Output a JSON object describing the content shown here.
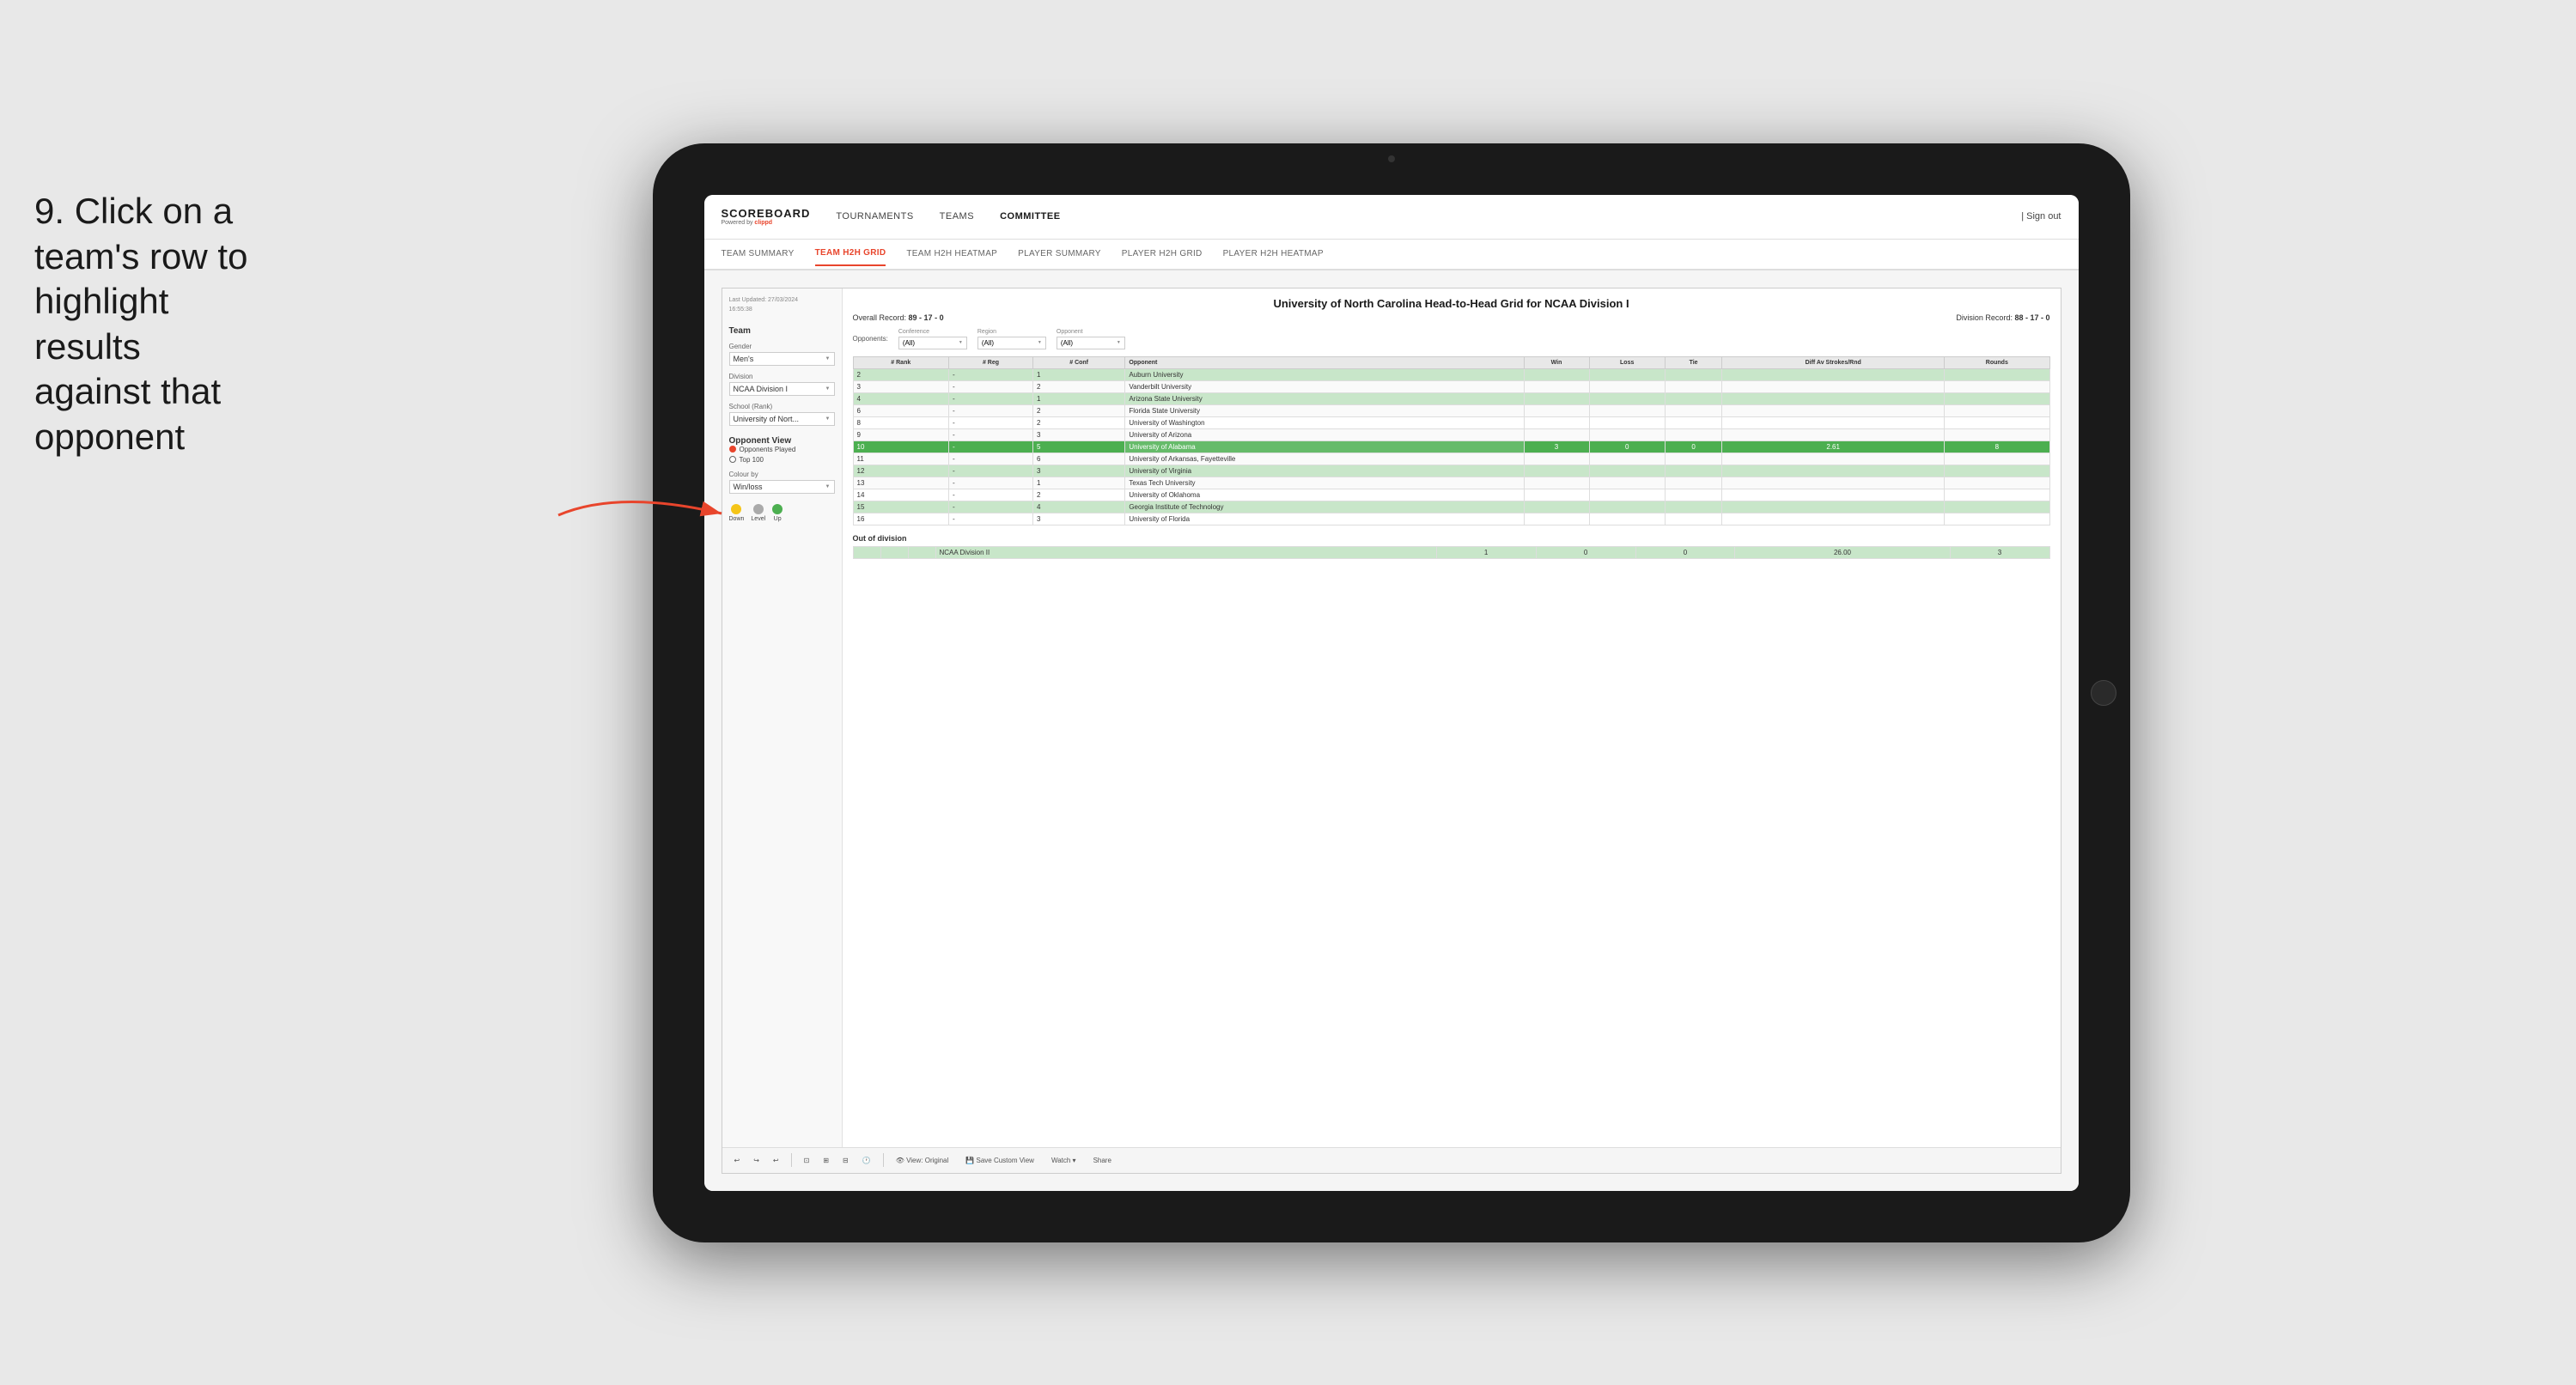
{
  "instruction": {
    "step": "9.",
    "text": "Click on a team's row to highlight results against that opponent"
  },
  "app": {
    "logo": "SCOREBOARD",
    "logo_sub": "Powered by clippd",
    "sign_out": "Sign out",
    "nav": {
      "tournaments": "TOURNAMENTS",
      "teams": "TEAMS",
      "committee": "COMMITTEE"
    },
    "sub_nav": [
      {
        "label": "TEAM SUMMARY",
        "active": false
      },
      {
        "label": "TEAM H2H GRID",
        "active": true
      },
      {
        "label": "TEAM H2H HEATMAP",
        "active": false
      },
      {
        "label": "PLAYER SUMMARY",
        "active": false
      },
      {
        "label": "PLAYER H2H GRID",
        "active": false
      },
      {
        "label": "PLAYER H2H HEATMAP",
        "active": false
      }
    ]
  },
  "sidebar": {
    "last_updated_label": "Last Updated: 27/03/2024",
    "last_updated_time": "16:55:38",
    "team_label": "Team",
    "gender_label": "Gender",
    "gender_value": "Men's",
    "division_label": "Division",
    "division_value": "NCAA Division I",
    "school_label": "School (Rank)",
    "school_value": "University of Nort...",
    "opponent_view_label": "Opponent View",
    "opponents_played": "Opponents Played",
    "top_100": "Top 100",
    "colour_by_label": "Colour by",
    "colour_by_value": "Win/loss",
    "colours": [
      {
        "name": "Down",
        "color": "#f5c518"
      },
      {
        "name": "Level",
        "color": "#aaaaaa"
      },
      {
        "name": "Up",
        "color": "#4caf50"
      }
    ]
  },
  "grid": {
    "title": "University of North Carolina Head-to-Head Grid for NCAA Division I",
    "overall_record_label": "Overall Record:",
    "overall_record": "89 - 17 - 0",
    "division_record_label": "Division Record:",
    "division_record": "88 - 17 - 0",
    "conference_filter_label": "Conference",
    "conference_filter_value": "(All)",
    "region_filter_label": "Region",
    "region_filter_value": "(All)",
    "opponent_filter_label": "Opponent",
    "opponent_filter_value": "(All)",
    "opponents_label": "Opponents:",
    "columns": {
      "rank": "# Rank",
      "reg": "# Reg",
      "conf": "# Conf",
      "opponent": "Opponent",
      "win": "Win",
      "loss": "Loss",
      "tie": "Tie",
      "diff_av": "Diff Av Strokes/Rnd",
      "rounds": "Rounds"
    },
    "rows": [
      {
        "rank": "2",
        "reg": "-",
        "conf": "1",
        "opponent": "Auburn University",
        "win": "",
        "loss": "",
        "tie": "",
        "diff": "",
        "rounds": "",
        "highlight": "light"
      },
      {
        "rank": "3",
        "reg": "-",
        "conf": "2",
        "opponent": "Vanderbilt University",
        "win": "",
        "loss": "",
        "tie": "",
        "diff": "",
        "rounds": "",
        "highlight": "light"
      },
      {
        "rank": "4",
        "reg": "-",
        "conf": "1",
        "opponent": "Arizona State University",
        "win": "",
        "loss": "",
        "tie": "",
        "diff": "",
        "rounds": "",
        "highlight": "light"
      },
      {
        "rank": "6",
        "reg": "-",
        "conf": "2",
        "opponent": "Florida State University",
        "win": "",
        "loss": "",
        "tie": "",
        "diff": "",
        "rounds": "",
        "highlight": "light"
      },
      {
        "rank": "8",
        "reg": "-",
        "conf": "2",
        "opponent": "University of Washington",
        "win": "",
        "loss": "",
        "tie": "",
        "diff": "",
        "rounds": "",
        "highlight": "none"
      },
      {
        "rank": "9",
        "reg": "-",
        "conf": "3",
        "opponent": "University of Arizona",
        "win": "",
        "loss": "",
        "tie": "",
        "diff": "",
        "rounds": "",
        "highlight": "none"
      },
      {
        "rank": "10",
        "reg": "-",
        "conf": "5",
        "opponent": "University of Alabama",
        "win": "3",
        "loss": "0",
        "tie": "0",
        "diff": "2.61",
        "rounds": "8",
        "highlight": "selected"
      },
      {
        "rank": "11",
        "reg": "-",
        "conf": "6",
        "opponent": "University of Arkansas, Fayetteville",
        "win": "",
        "loss": "",
        "tie": "",
        "diff": "",
        "rounds": "",
        "highlight": "light"
      },
      {
        "rank": "12",
        "reg": "-",
        "conf": "3",
        "opponent": "University of Virginia",
        "win": "",
        "loss": "",
        "tie": "",
        "diff": "",
        "rounds": "",
        "highlight": "light"
      },
      {
        "rank": "13",
        "reg": "-",
        "conf": "1",
        "opponent": "Texas Tech University",
        "win": "",
        "loss": "",
        "tie": "",
        "diff": "",
        "rounds": "",
        "highlight": "light"
      },
      {
        "rank": "14",
        "reg": "-",
        "conf": "2",
        "opponent": "University of Oklahoma",
        "win": "",
        "loss": "",
        "tie": "",
        "diff": "",
        "rounds": "",
        "highlight": "light"
      },
      {
        "rank": "15",
        "reg": "-",
        "conf": "4",
        "opponent": "Georgia Institute of Technology",
        "win": "",
        "loss": "",
        "tie": "",
        "diff": "",
        "rounds": "",
        "highlight": "light"
      },
      {
        "rank": "16",
        "reg": "-",
        "conf": "3",
        "opponent": "University of Florida",
        "win": "",
        "loss": "",
        "tie": "",
        "diff": "",
        "rounds": "",
        "highlight": "light"
      }
    ],
    "out_of_division_title": "Out of division",
    "out_of_division_rows": [
      {
        "opponent": "NCAA Division II",
        "win": "1",
        "loss": "0",
        "tie": "0",
        "diff": "26.00",
        "rounds": "3"
      }
    ]
  },
  "toolbar": {
    "undo": "↩",
    "redo": "↪",
    "view_original": "View: Original",
    "save_custom": "Save Custom View",
    "watch": "Watch ▾",
    "share": "Share"
  }
}
